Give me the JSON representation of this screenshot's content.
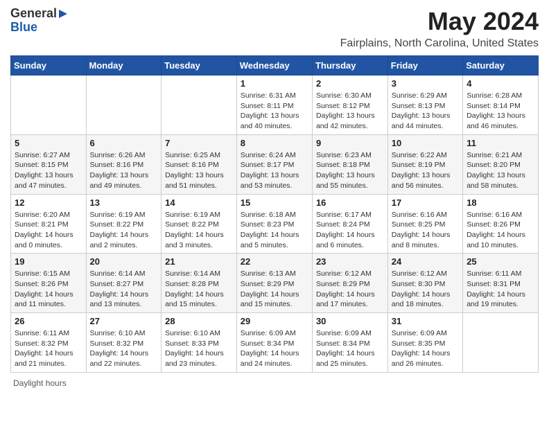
{
  "logo": {
    "line1": "General",
    "line2": "Blue"
  },
  "title": "May 2024",
  "subtitle": "Fairplains, North Carolina, United States",
  "days_of_week": [
    "Sunday",
    "Monday",
    "Tuesday",
    "Wednesday",
    "Thursday",
    "Friday",
    "Saturday"
  ],
  "footer": {
    "daylight_label": "Daylight hours"
  },
  "weeks": [
    {
      "days": [
        {
          "date": "",
          "info": ""
        },
        {
          "date": "",
          "info": ""
        },
        {
          "date": "",
          "info": ""
        },
        {
          "date": "1",
          "info": "Sunrise: 6:31 AM\nSunset: 8:11 PM\nDaylight: 13 hours\nand 40 minutes."
        },
        {
          "date": "2",
          "info": "Sunrise: 6:30 AM\nSunset: 8:12 PM\nDaylight: 13 hours\nand 42 minutes."
        },
        {
          "date": "3",
          "info": "Sunrise: 6:29 AM\nSunset: 8:13 PM\nDaylight: 13 hours\nand 44 minutes."
        },
        {
          "date": "4",
          "info": "Sunrise: 6:28 AM\nSunset: 8:14 PM\nDaylight: 13 hours\nand 46 minutes."
        }
      ]
    },
    {
      "days": [
        {
          "date": "5",
          "info": "Sunrise: 6:27 AM\nSunset: 8:15 PM\nDaylight: 13 hours\nand 47 minutes."
        },
        {
          "date": "6",
          "info": "Sunrise: 6:26 AM\nSunset: 8:16 PM\nDaylight: 13 hours\nand 49 minutes."
        },
        {
          "date": "7",
          "info": "Sunrise: 6:25 AM\nSunset: 8:16 PM\nDaylight: 13 hours\nand 51 minutes."
        },
        {
          "date": "8",
          "info": "Sunrise: 6:24 AM\nSunset: 8:17 PM\nDaylight: 13 hours\nand 53 minutes."
        },
        {
          "date": "9",
          "info": "Sunrise: 6:23 AM\nSunset: 8:18 PM\nDaylight: 13 hours\nand 55 minutes."
        },
        {
          "date": "10",
          "info": "Sunrise: 6:22 AM\nSunset: 8:19 PM\nDaylight: 13 hours\nand 56 minutes."
        },
        {
          "date": "11",
          "info": "Sunrise: 6:21 AM\nSunset: 8:20 PM\nDaylight: 13 hours\nand 58 minutes."
        }
      ]
    },
    {
      "days": [
        {
          "date": "12",
          "info": "Sunrise: 6:20 AM\nSunset: 8:21 PM\nDaylight: 14 hours\nand 0 minutes."
        },
        {
          "date": "13",
          "info": "Sunrise: 6:19 AM\nSunset: 8:22 PM\nDaylight: 14 hours\nand 2 minutes."
        },
        {
          "date": "14",
          "info": "Sunrise: 6:19 AM\nSunset: 8:22 PM\nDaylight: 14 hours\nand 3 minutes."
        },
        {
          "date": "15",
          "info": "Sunrise: 6:18 AM\nSunset: 8:23 PM\nDaylight: 14 hours\nand 5 minutes."
        },
        {
          "date": "16",
          "info": "Sunrise: 6:17 AM\nSunset: 8:24 PM\nDaylight: 14 hours\nand 6 minutes."
        },
        {
          "date": "17",
          "info": "Sunrise: 6:16 AM\nSunset: 8:25 PM\nDaylight: 14 hours\nand 8 minutes."
        },
        {
          "date": "18",
          "info": "Sunrise: 6:16 AM\nSunset: 8:26 PM\nDaylight: 14 hours\nand 10 minutes."
        }
      ]
    },
    {
      "days": [
        {
          "date": "19",
          "info": "Sunrise: 6:15 AM\nSunset: 8:26 PM\nDaylight: 14 hours\nand 11 minutes."
        },
        {
          "date": "20",
          "info": "Sunrise: 6:14 AM\nSunset: 8:27 PM\nDaylight: 14 hours\nand 13 minutes."
        },
        {
          "date": "21",
          "info": "Sunrise: 6:14 AM\nSunset: 8:28 PM\nDaylight: 14 hours\nand 15 minutes."
        },
        {
          "date": "22",
          "info": "Sunrise: 6:13 AM\nSunset: 8:29 PM\nDaylight: 14 hours\nand 15 minutes."
        },
        {
          "date": "23",
          "info": "Sunrise: 6:12 AM\nSunset: 8:29 PM\nDaylight: 14 hours\nand 17 minutes."
        },
        {
          "date": "24",
          "info": "Sunrise: 6:12 AM\nSunset: 8:30 PM\nDaylight: 14 hours\nand 18 minutes."
        },
        {
          "date": "25",
          "info": "Sunrise: 6:11 AM\nSunset: 8:31 PM\nDaylight: 14 hours\nand 19 minutes."
        }
      ]
    },
    {
      "days": [
        {
          "date": "26",
          "info": "Sunrise: 6:11 AM\nSunset: 8:32 PM\nDaylight: 14 hours\nand 21 minutes."
        },
        {
          "date": "27",
          "info": "Sunrise: 6:10 AM\nSunset: 8:32 PM\nDaylight: 14 hours\nand 22 minutes."
        },
        {
          "date": "28",
          "info": "Sunrise: 6:10 AM\nSunset: 8:33 PM\nDaylight: 14 hours\nand 23 minutes."
        },
        {
          "date": "29",
          "info": "Sunrise: 6:09 AM\nSunset: 8:34 PM\nDaylight: 14 hours\nand 24 minutes."
        },
        {
          "date": "30",
          "info": "Sunrise: 6:09 AM\nSunset: 8:34 PM\nDaylight: 14 hours\nand 25 minutes."
        },
        {
          "date": "31",
          "info": "Sunrise: 6:09 AM\nSunset: 8:35 PM\nDaylight: 14 hours\nand 26 minutes."
        },
        {
          "date": "",
          "info": ""
        }
      ]
    }
  ]
}
